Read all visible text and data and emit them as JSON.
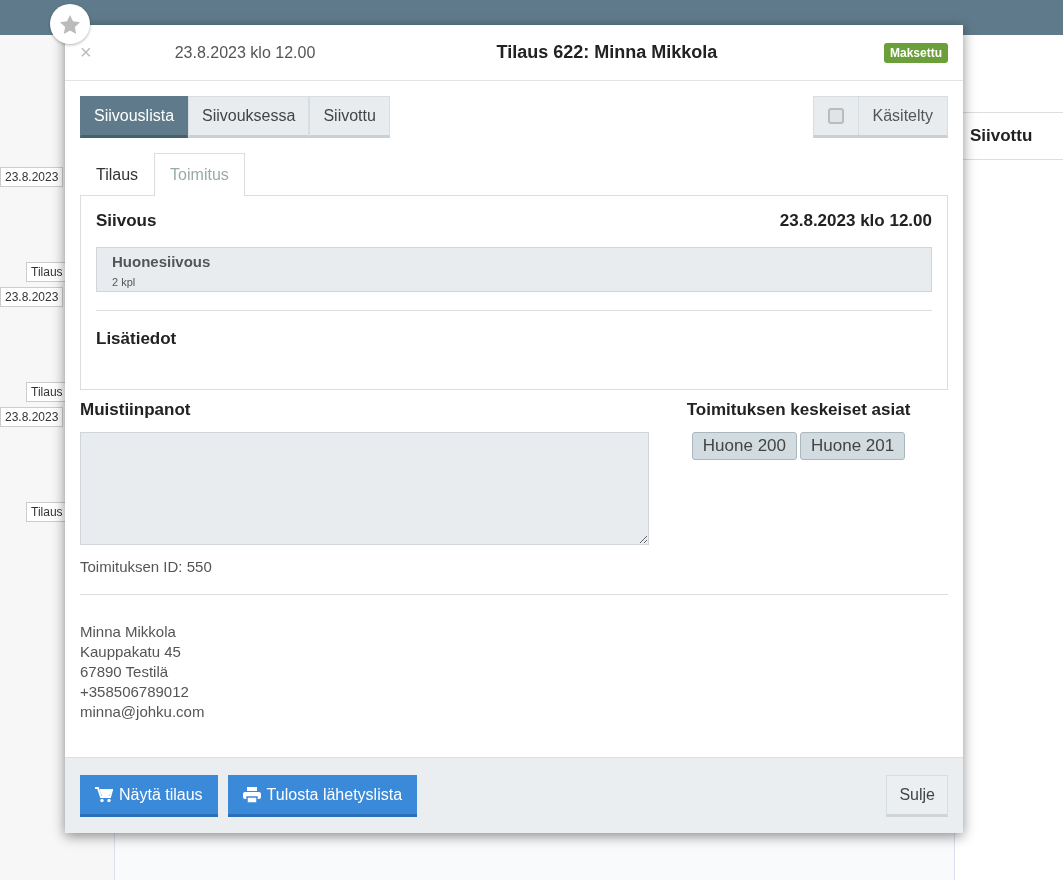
{
  "background": {
    "labels": [
      {
        "kind": "date",
        "text": "23.8.2023"
      },
      {
        "kind": "order",
        "text": "Tilaus"
      },
      {
        "kind": "date",
        "text": "23.8.2023"
      },
      {
        "kind": "order",
        "text": "Tilaus"
      },
      {
        "kind": "date",
        "text": "23.8.2023"
      },
      {
        "kind": "order",
        "text": "Tilaus"
      }
    ],
    "column_heading": "Siivottu"
  },
  "modal": {
    "close": "×",
    "date": "23.8.2023 klo 12.00",
    "title": "Tilaus 622: Minna Mikkola",
    "badge": "Maksettu",
    "status_buttons": [
      {
        "label": "Siivouslista",
        "selected": true
      },
      {
        "label": "Siivouksessa",
        "selected": false
      },
      {
        "label": "Siivottu",
        "selected": false
      }
    ],
    "processed": {
      "label": "Käsitelty",
      "checked": false
    },
    "tabs": [
      {
        "label": "Tilaus",
        "selected": false
      },
      {
        "label": "Toimitus",
        "selected": true
      }
    ],
    "service": {
      "heading": "Siivous",
      "datetime": "23.8.2023 klo 12.00",
      "items": [
        {
          "name": "Huonesiivous",
          "quantity": "2 kpl"
        }
      ]
    },
    "extra_info_heading": "Lisätiedot",
    "notes": {
      "label": "Muistiinpanot"
    },
    "key_points": {
      "heading": "Toimituksen keskeiset asiat",
      "tags": [
        "Huone 200",
        "Huone 201"
      ]
    },
    "delivery_id": "Toimituksen ID: 550",
    "address": [
      "Minna Mikkola",
      "Kauppakatu 45",
      "67890 Testilä",
      "+358506789012",
      "minna@johku.com"
    ],
    "footer": {
      "buttons": [
        {
          "label": "Näytä tilaus",
          "kind": "cart"
        },
        {
          "label": "Tulosta lähetyslista",
          "kind": "print"
        }
      ],
      "close_button": "Sulje"
    }
  }
}
